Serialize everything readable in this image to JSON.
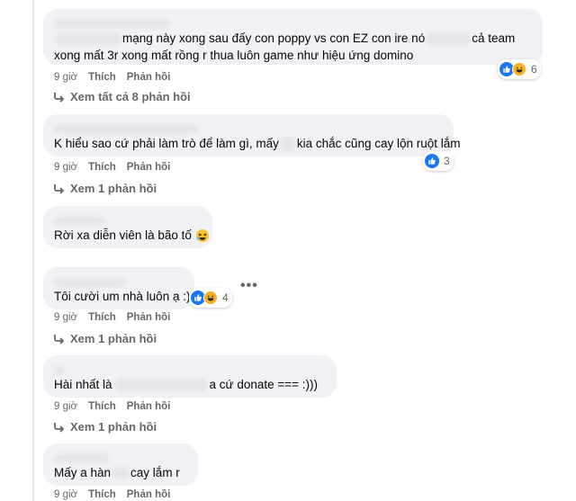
{
  "comments": [
    {
      "text_line1": "mạng này xong sau đấy con poppy vs con EZ con ire nó",
      "text_line1_tail": "cả team",
      "text_line2": "xong mất 3r xong mất rồng r thua luôn game như hiệu ứng domino",
      "reaction_count": "6",
      "time": "9 giờ",
      "like_label": "Thích",
      "reply_label": "Phản hồi",
      "replies_label": "Xem tất cả 8 phản hồi"
    },
    {
      "text_before": "K hiểu sao cứ phải làm trò để làm gì, mấy",
      "text_after": "kia chắc cũng cay lộn ruột lắm",
      "reaction_count": "3",
      "time": "9 giờ",
      "like_label": "Thích",
      "reply_label": "Phản hồi",
      "replies_label": "Xem 1 phản hồi"
    },
    {
      "text": "Rời xa diễn viên là bão tố",
      "emoji": "laughing-face-icon"
    },
    {
      "text": "Tôi cười um nhà luôn ạ :))",
      "reaction_count": "4",
      "time": "9 giờ",
      "like_label": "Thích",
      "reply_label": "Phản hồi",
      "replies_label": "Xem 1 phản hồi",
      "more": "•••"
    },
    {
      "text_before": "Hài nhất là",
      "text_after": "a cứ donate === :)))",
      "time": "9 giờ",
      "like_label": "Thích",
      "reply_label": "Phản hồi",
      "replies_label": "Xem 1 phản hồi"
    },
    {
      "text_before": "Mấy a hàn",
      "text_after": "cay lắm r",
      "time": "9 giờ",
      "like_label": "Thích",
      "reply_label": "Phản hồi"
    }
  ],
  "colors": {
    "bubble": "#f0f2f5",
    "meta_text": "#65676b",
    "like_blue": "#1877f2",
    "haha_yellow": "#f7b125"
  }
}
